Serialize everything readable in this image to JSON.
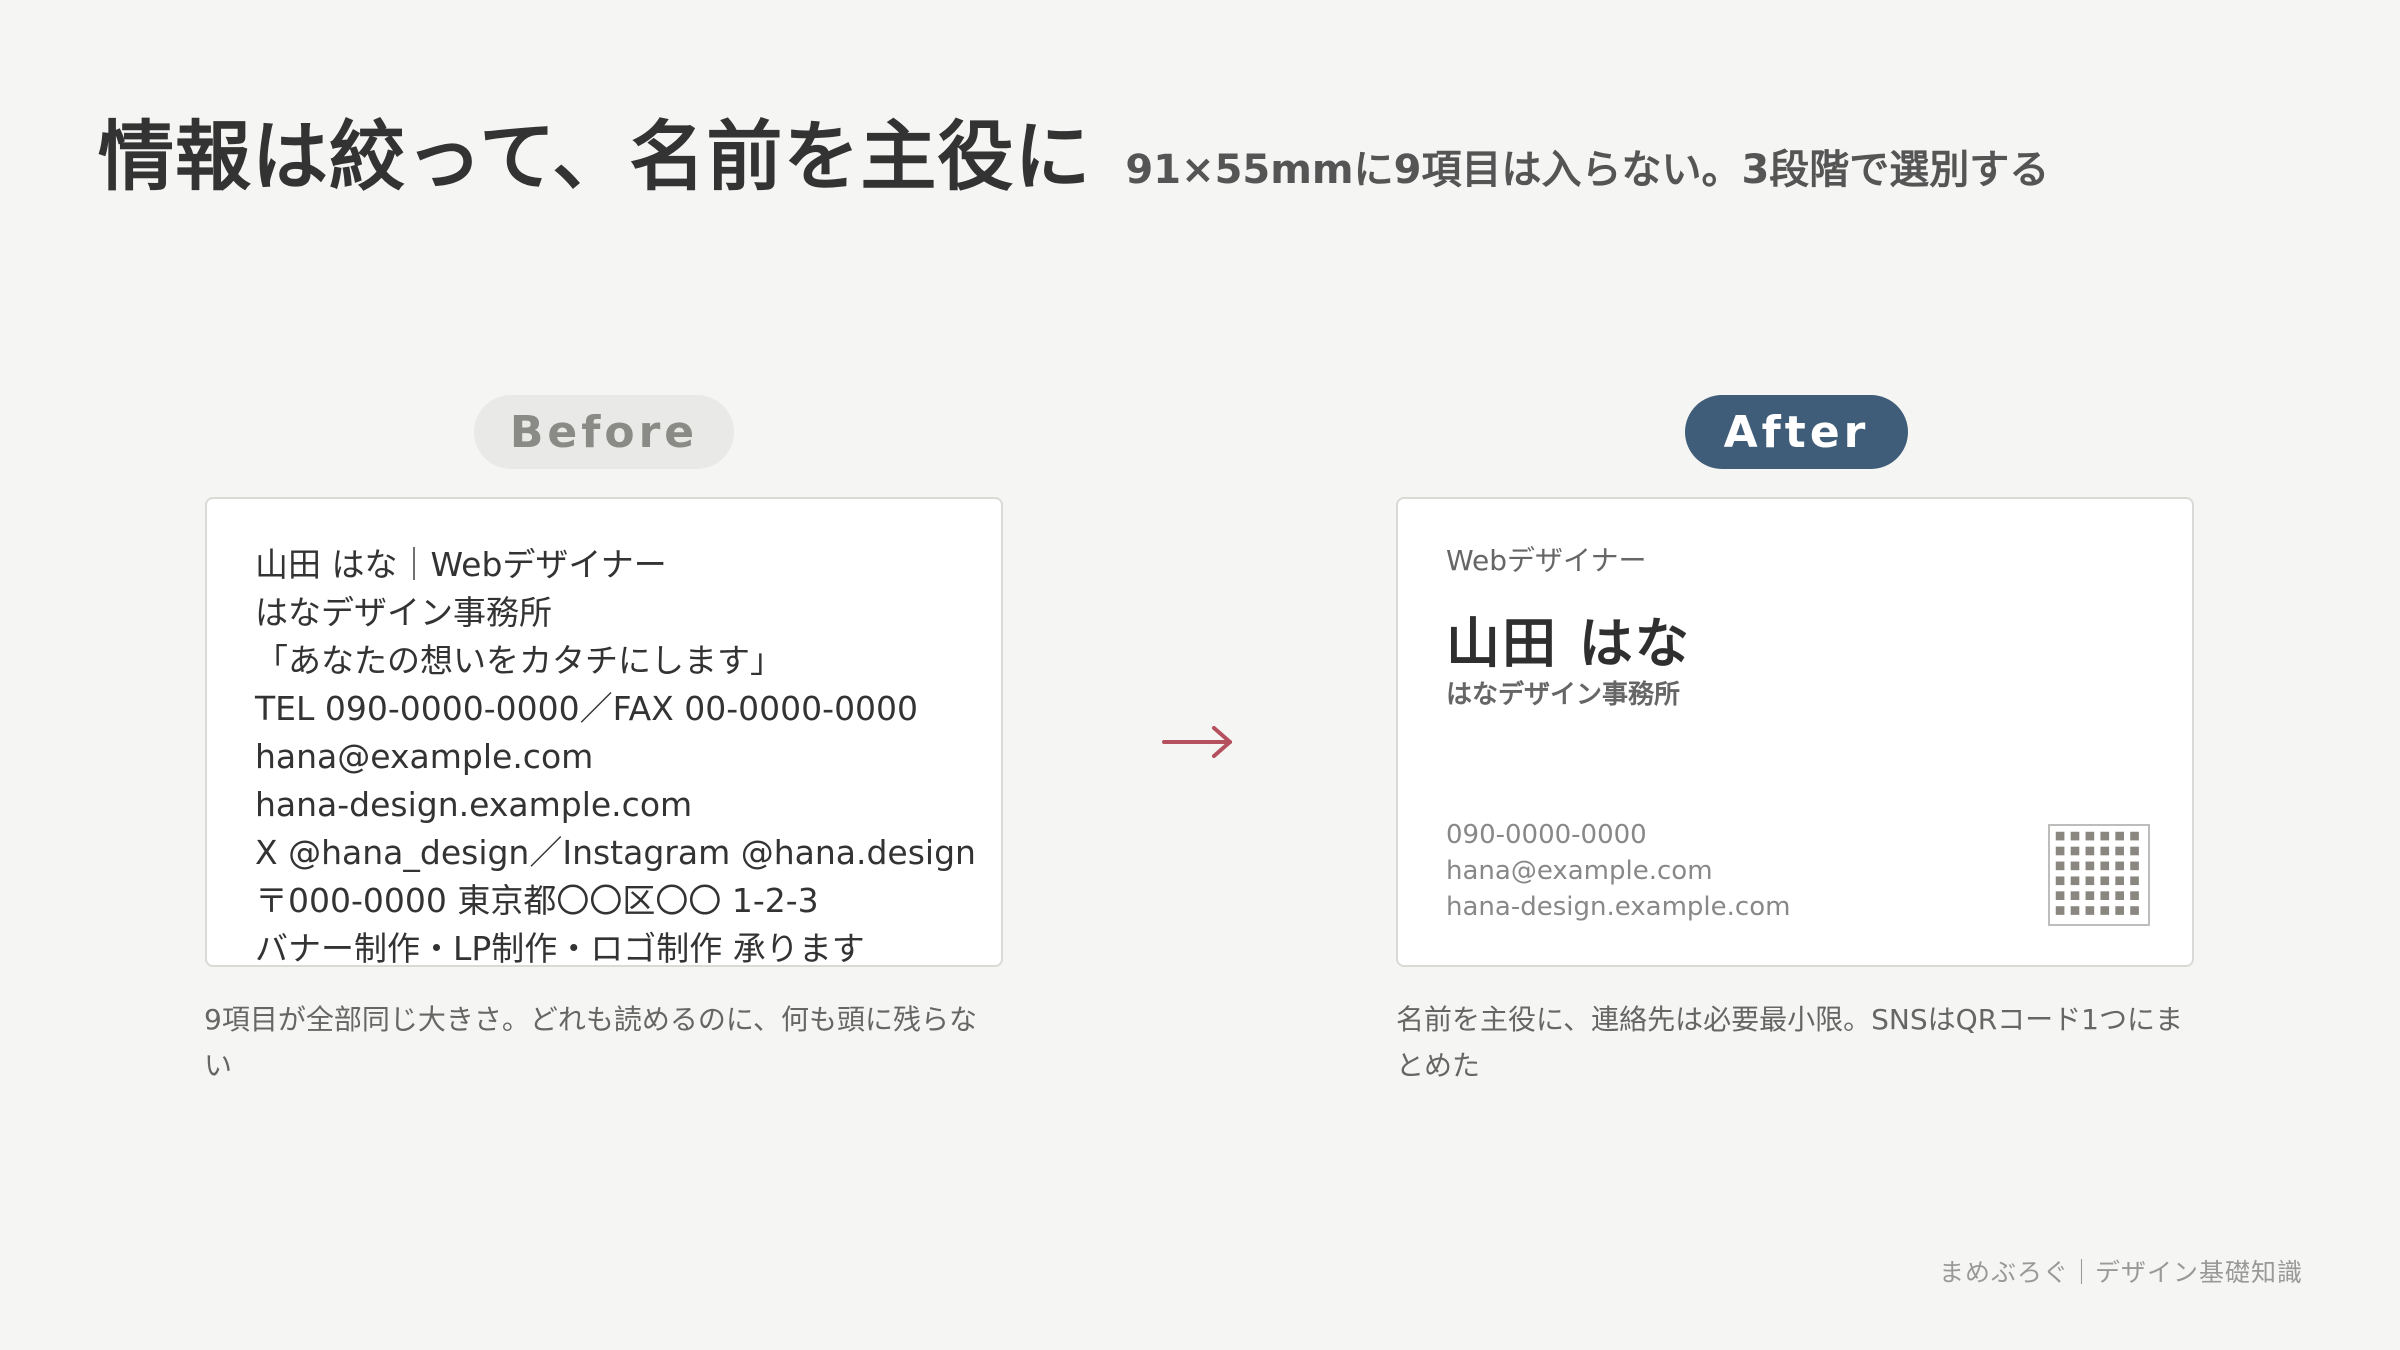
{
  "header": {
    "title": "情報は絞って、名前を主役に",
    "subtitle": "91×55mmに9項目は入らない。3段階で選別する"
  },
  "before": {
    "badge": "Before",
    "lines": [
      "山田 はな｜Webデザイナー",
      "はなデザイン事務所",
      "「あなたの想いをカタチにします」",
      "TEL 090-0000-0000／FAX 00-0000-0000",
      "hana@example.com",
      "hana-design.example.com",
      "X @hana_design／Instagram @hana.design",
      "〒000-0000 東京都〇〇区〇〇 1-2-3",
      "バナー制作・LP制作・ロゴ制作 承ります"
    ],
    "caption": "9項目が全部同じ大きさ。どれも読めるのに、何も頭に残らない"
  },
  "after": {
    "badge": "After",
    "role": "Webデザイナー",
    "name": "山田 はな",
    "office": "はなデザイン事務所",
    "contacts": [
      "090-0000-0000",
      "hana@example.com",
      "hana-design.example.com"
    ],
    "qr_icon": "qr-code-icon",
    "caption": "名前を主役に、連絡先は必要最小限。SNSはQRコード1つにまとめた"
  },
  "arrow_icon": "right-arrow-icon",
  "footer": "まめぶろぐ｜デザイン基礎知識",
  "colors": {
    "background": "#f5f5f3",
    "accent_after": "#3f5d78",
    "arrow": "#b5505e",
    "badge_before": "#e9e9e7"
  }
}
